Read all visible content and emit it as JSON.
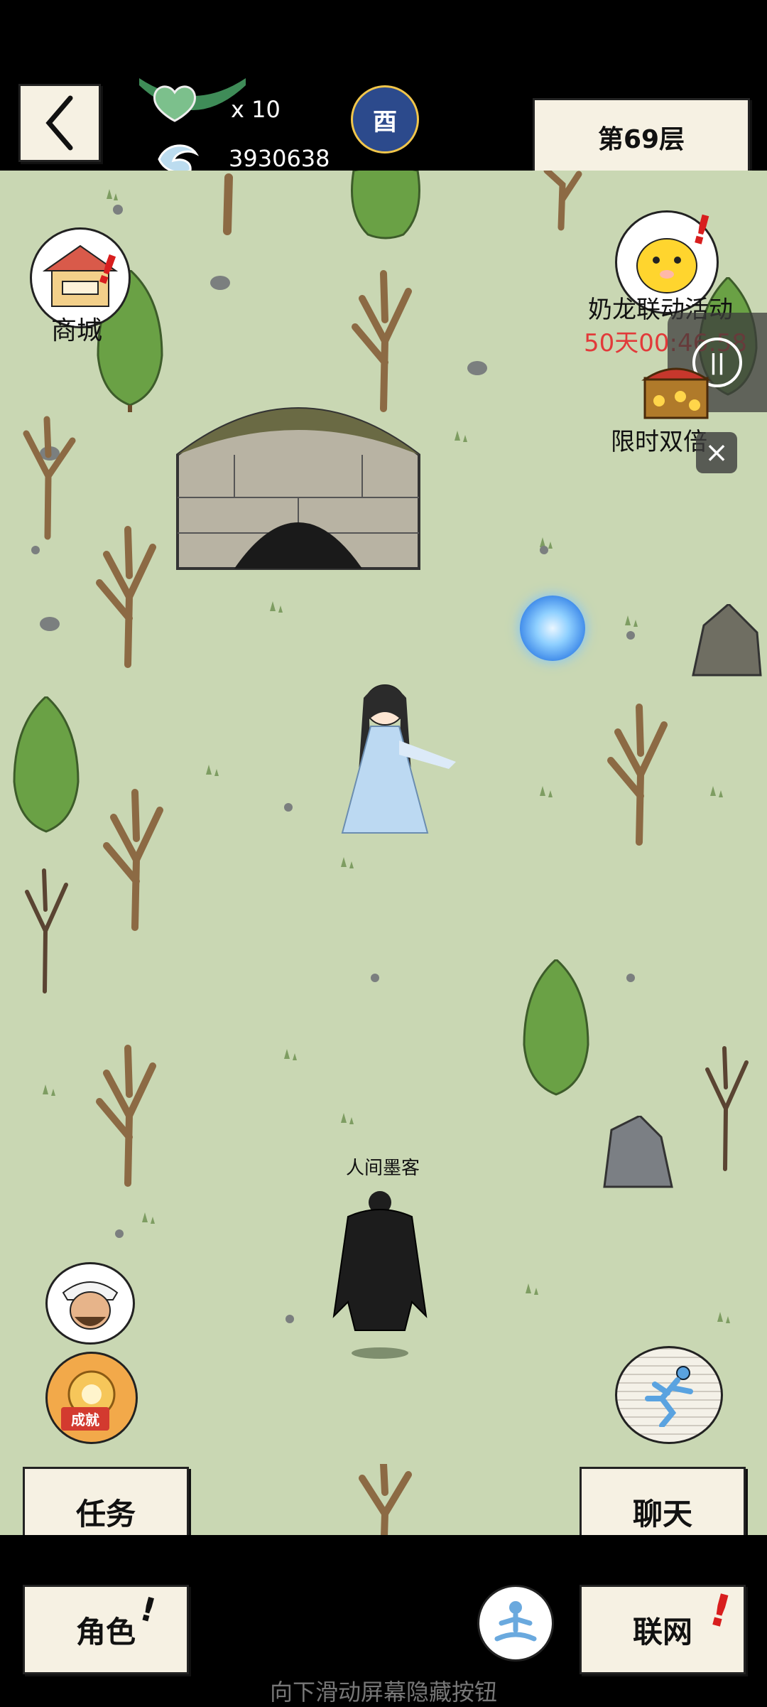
{
  "header": {
    "back_label": "<",
    "lives_count": "x 10",
    "currency_value": "3930638",
    "moon_badge": "酉",
    "floor_label": "第69层"
  },
  "left_icons": {
    "shop_label": "商城"
  },
  "right_panel": {
    "event_title": "奶龙联动活动",
    "event_timer": "50天00:46:58",
    "double_label": "限时双倍"
  },
  "characters": {
    "npc_name": "人间墨客"
  },
  "buttons": {
    "task": "任务",
    "chat": "聊天",
    "role": "角色",
    "network": "联网",
    "pause_icon": "||",
    "close_icon": "×",
    "achievement_label": "成就"
  },
  "hint": "向下滑动屏幕隐藏按钮",
  "colors": {
    "map_bg": "#c9d7b3",
    "alert_red": "#d81e1e",
    "timer_red": "#e23a3a"
  }
}
